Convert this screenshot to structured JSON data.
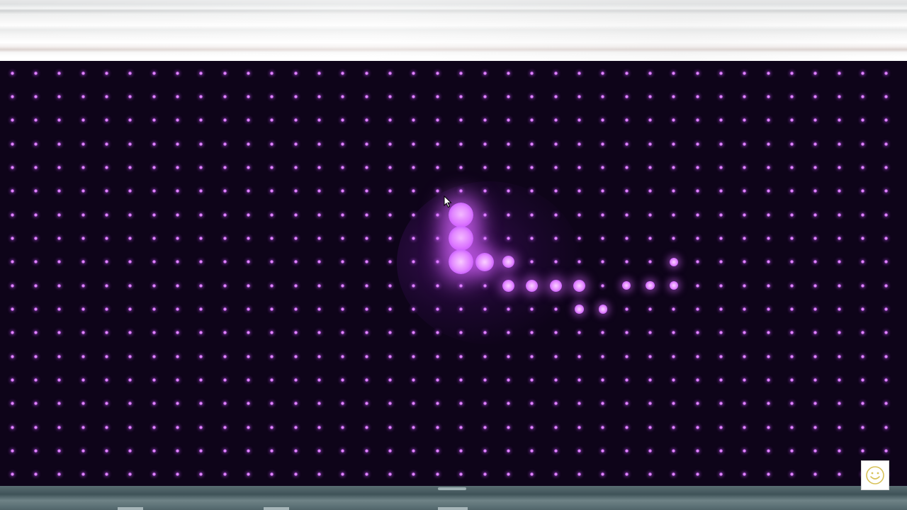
{
  "window": {
    "top_bar": "blurred-browser-chrome",
    "bottom_bar": "blurred-taskbar"
  },
  "grid": {
    "columns": 38,
    "rows": 18,
    "lit_dots": [
      {
        "col": 19,
        "row": 6,
        "level": 3
      },
      {
        "col": 19,
        "row": 7,
        "level": 3
      },
      {
        "col": 19,
        "row": 8,
        "level": 3
      },
      {
        "col": 20,
        "row": 8,
        "level": 2
      },
      {
        "col": 21,
        "row": 8,
        "level": 1
      },
      {
        "col": 21,
        "row": 9,
        "level": 1
      },
      {
        "col": 22,
        "row": 9,
        "level": 1
      },
      {
        "col": 23,
        "row": 9,
        "level": 1
      },
      {
        "col": 24,
        "row": 9,
        "level": 1
      },
      {
        "col": 24,
        "row": 10,
        "level": 0.5
      },
      {
        "col": 25,
        "row": 10,
        "level": 0.5
      },
      {
        "col": 26,
        "row": 9,
        "level": 0.5
      },
      {
        "col": 27,
        "row": 9,
        "level": 0.5
      },
      {
        "col": 28,
        "row": 9,
        "level": 0.5
      },
      {
        "col": 28,
        "row": 8,
        "level": 0.5
      }
    ]
  },
  "colors": {
    "background": "#0e0419",
    "dot": "#d56bff",
    "dot_lit": "#e38bff"
  },
  "icons": {
    "cursor": "mouse-pointer-icon",
    "badge": "smiley-face-icon"
  }
}
